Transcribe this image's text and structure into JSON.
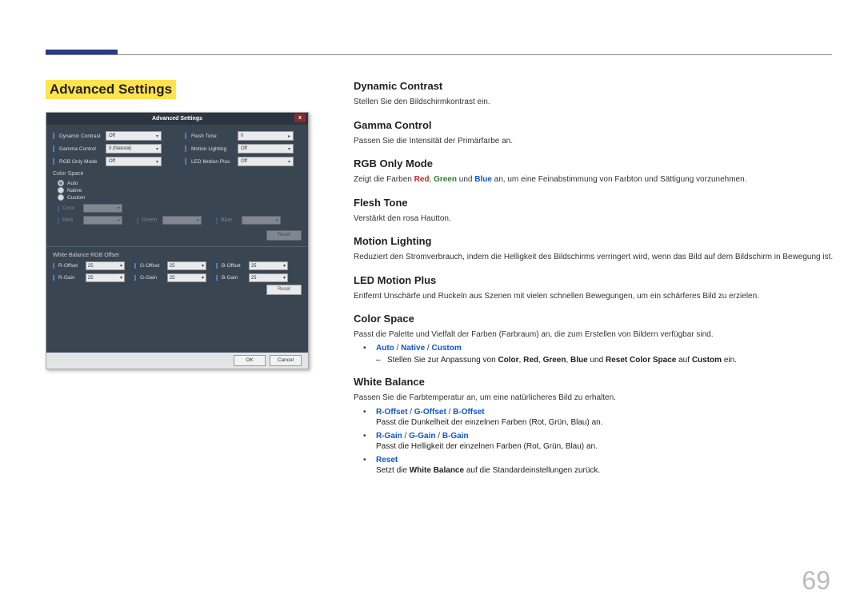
{
  "page": {
    "number": "69"
  },
  "sectionTitle": "Advanced Settings",
  "dialog": {
    "title": "Advanced Settings",
    "close": "x",
    "rows": [
      [
        {
          "label": "Dynamic Contrast",
          "value": "Off"
        },
        {
          "label": "Flesh Tone",
          "value": "0"
        }
      ],
      [
        {
          "label": "Gamma Control",
          "value": "0 (Natural)"
        },
        {
          "label": "Motion Lighting",
          "value": "Off"
        }
      ],
      [
        {
          "label": "RGB Only Mode",
          "value": "Off"
        },
        {
          "label": "LED Motion Plus",
          "value": "Off"
        }
      ]
    ],
    "colorSpace": {
      "title": "Color Space",
      "options": [
        "Auto",
        "Native",
        "Custom"
      ],
      "selected": 0,
      "custom": {
        "colorLabel": "Color",
        "channels": [
          "Red",
          "Green",
          "Blue"
        ],
        "reset": "Reset"
      }
    },
    "whiteBalance": {
      "title": "White Balance  RGB Offset",
      "items": [
        {
          "label": "R-Offset",
          "value": "25"
        },
        {
          "label": "G-Offset",
          "value": "25"
        },
        {
          "label": "B-Offset",
          "value": "25"
        },
        {
          "label": "R-Gain",
          "value": "25"
        },
        {
          "label": "G-Gain",
          "value": "25"
        },
        {
          "label": "B-Gain",
          "value": "25"
        }
      ],
      "reset": "Reset"
    },
    "footer": {
      "ok": "OK",
      "cancel": "Cancel"
    }
  },
  "doc": {
    "dynamicContrast": {
      "title": "Dynamic Contrast",
      "desc": "Stellen Sie den Bildschirmkontrast ein."
    },
    "gammaControl": {
      "title": "Gamma Control",
      "desc": "Passen Sie die Intensität der Primärfarbe an."
    },
    "rgbOnly": {
      "title": "RGB Only Mode",
      "pre": "Zeigt die Farben ",
      "r": "Red",
      "g": "Green",
      "b": "Blue",
      "mid1": ", ",
      "mid2": " und ",
      "post": " an, um eine Feinabstimmung von Farbton und Sättigung vorzunehmen."
    },
    "fleshTone": {
      "title": "Flesh Tone",
      "desc": "Verstärkt den rosa Hautton."
    },
    "motionLighting": {
      "title": "Motion Lighting",
      "desc": "Reduziert den Stromverbrauch, indem die Helligkeit des Bildschirms verringert wird, wenn das Bild auf dem Bildschirm in Bewegung ist."
    },
    "ledMotionPlus": {
      "title": "LED Motion Plus",
      "desc": "Entfernt Unschärfe und Ruckeln aus Szenen mit vielen schnellen Bewegungen, um ein schärferes Bild zu erzielen."
    },
    "colorSpace": {
      "title": "Color Space",
      "desc": "Passt die Palette und Vielfalt der Farben (Farbraum) an, die zum Erstellen von Bildern verfügbar sind.",
      "opts": {
        "auto": "Auto",
        "native": "Native",
        "custom": "Custom",
        "sep": " / "
      },
      "dash": {
        "pre": "Stellen Sie zur Anpassung von ",
        "color": "Color",
        "red": "Red",
        "green": "Green",
        "blue": "Blue",
        "reset": "Reset Color Space",
        "on": "Custom",
        "c1": ", ",
        "c2": ", ",
        "c3": ", ",
        "und": " und ",
        "auf": " auf ",
        "ein": " ein."
      }
    },
    "whiteBalance": {
      "title": "White Balance",
      "desc": "Passen Sie die Farbtemperatur an, um eine natürlicheres Bild zu erhalten.",
      "offset": {
        "r": "R-Offset",
        "g": "G-Offset",
        "b": "B-Offset",
        "sep": " / ",
        "desc": "Passt die Dunkelheit der einzelnen Farben (Rot, Grün, Blau) an."
      },
      "gain": {
        "r": "R-Gain",
        "g": "G-Gain",
        "b": "B-Gain",
        "sep": " / ",
        "desc": "Passt die Helligkeit der einzelnen Farben (Rot, Grün, Blau) an."
      },
      "reset": {
        "title": "Reset",
        "pre": "Setzt die ",
        "wb": "White Balance",
        "post": " auf die Standardeinstellungen zurück."
      }
    }
  }
}
